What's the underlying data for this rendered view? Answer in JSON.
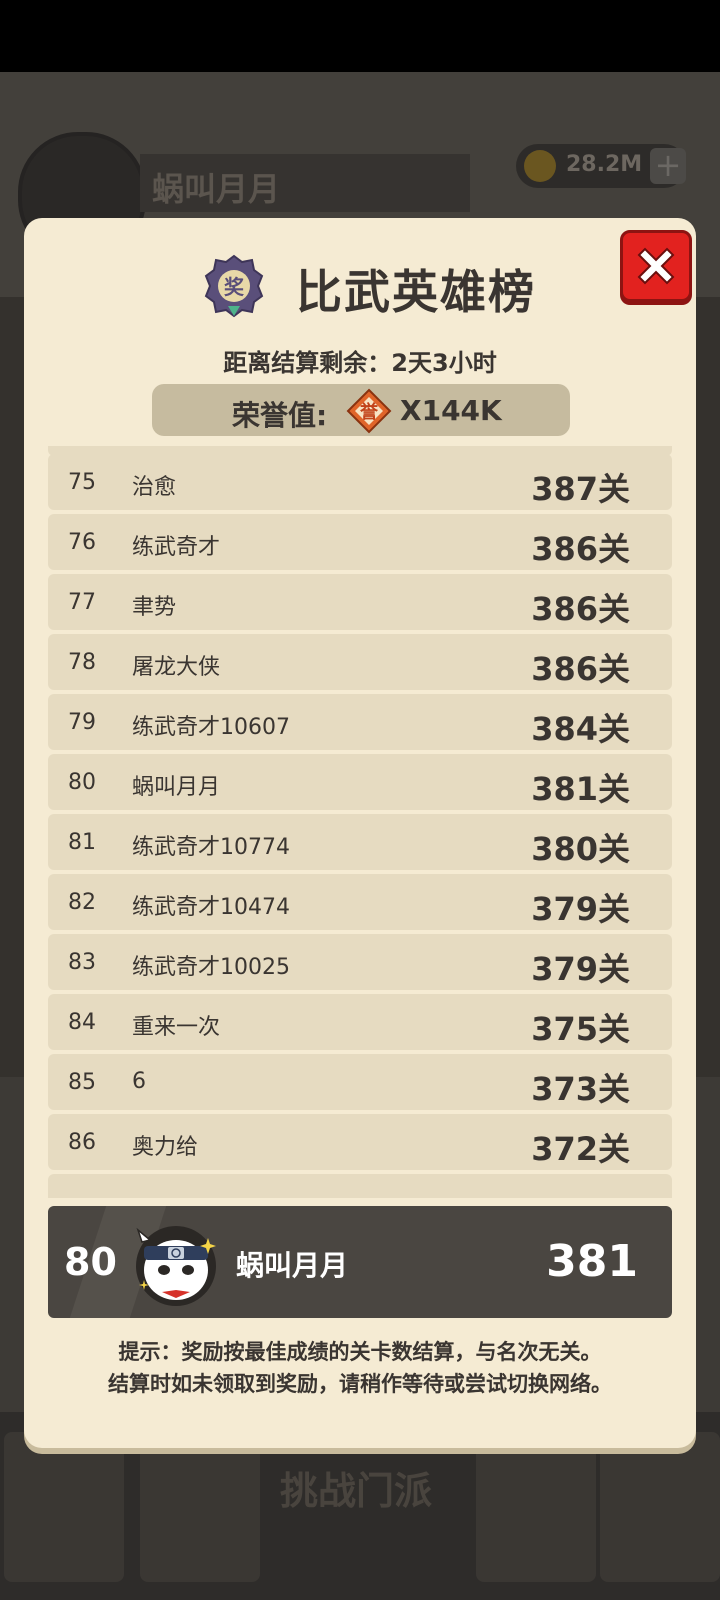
{
  "background": {
    "player_name": "蜗叫月月",
    "coins": "28.2M",
    "nav_challenge": "挑战门派"
  },
  "modal": {
    "title": "比武英雄榜",
    "badge_glyph": "奖",
    "countdown": "距离结算剩余：2天3小时",
    "honor_label": "荣誉值:",
    "honor_glyph": "誉",
    "honor_value": "X144K"
  },
  "ranking": [
    {
      "rank": "75",
      "name": "治愈",
      "score": "387关"
    },
    {
      "rank": "76",
      "name": "练武奇才",
      "score": "386关"
    },
    {
      "rank": "77",
      "name": "聿势",
      "score": "386关"
    },
    {
      "rank": "78",
      "name": "屠龙大侠",
      "score": "386关"
    },
    {
      "rank": "79",
      "name": "练武奇才10607",
      "score": "384关"
    },
    {
      "rank": "80",
      "name": "蜗叫月月",
      "score": "381关"
    },
    {
      "rank": "81",
      "name": "练武奇才10774",
      "score": "380关"
    },
    {
      "rank": "82",
      "name": "练武奇才10474",
      "score": "379关"
    },
    {
      "rank": "83",
      "name": "练武奇才10025",
      "score": "379关"
    },
    {
      "rank": "84",
      "name": "重来一次",
      "score": "375关"
    },
    {
      "rank": "85",
      "name": "6",
      "score": "373关"
    },
    {
      "rank": "86",
      "name": "奥力给",
      "score": "372关"
    }
  ],
  "my_rank": {
    "rank": "80",
    "name": "蜗叫月月",
    "score": "381"
  },
  "tips": {
    "line1": "提示：奖励按最佳成绩的关卡数结算，与名次无关。",
    "line2": "结算时如未领取到奖励，请稍作等待或尝试切换网络。"
  },
  "colors": {
    "panel_bg": "#f5ebd3",
    "row_bg": "#e6dbc1",
    "my_rank_bg": "#4a4641",
    "close_red": "#e2221f",
    "honor_orange": "#e0652a"
  }
}
